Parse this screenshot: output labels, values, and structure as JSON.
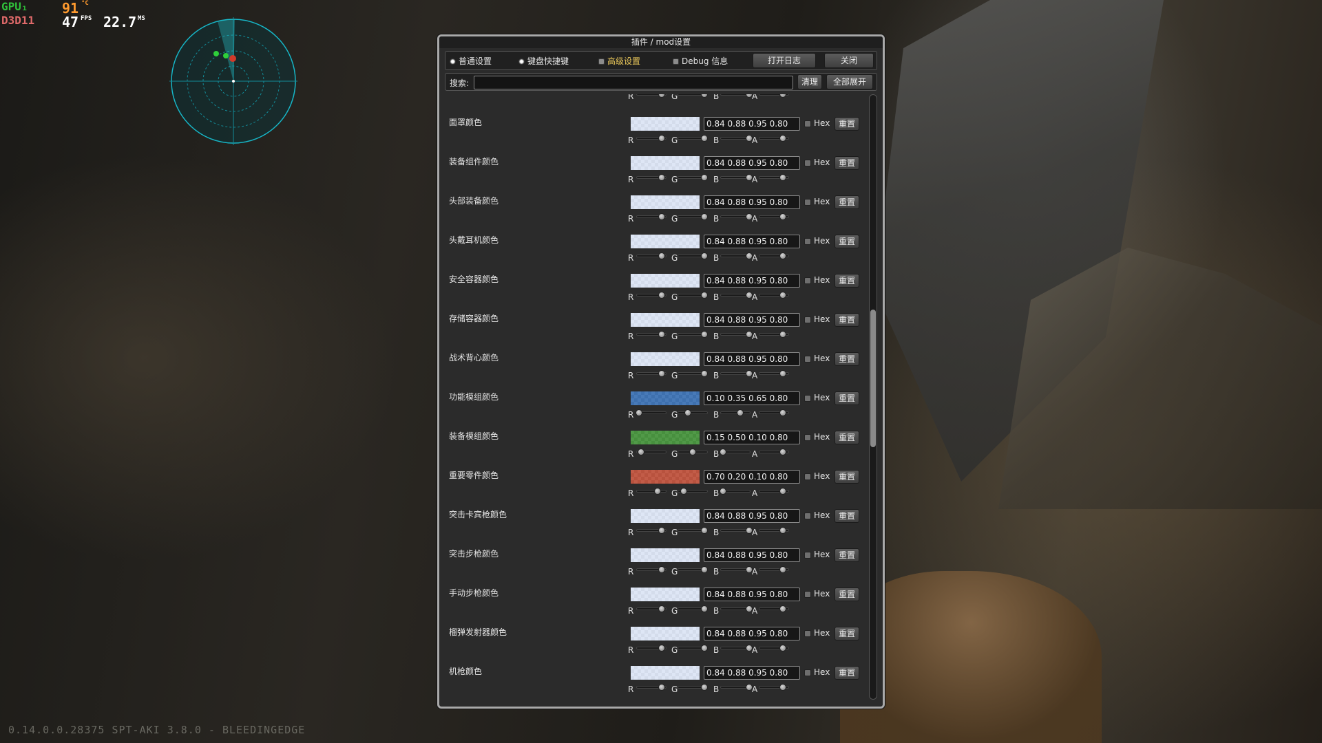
{
  "overlay": {
    "gpu_label": "GPU₁",
    "api_label": "D3D11",
    "temp": "91",
    "temp_unit": "°C",
    "fps": "47",
    "fps_unit": "FPS",
    "frametime": "22.7",
    "frametime_unit": "MS"
  },
  "version": "0.14.0.0.28375 SPT-AKI 3.8.0 - BLEEDINGEDGE",
  "window": {
    "title": "插件 / mod设置",
    "tabs": [
      {
        "label": "普通设置",
        "selected": true
      },
      {
        "label": "键盘快捷键",
        "selected": true
      },
      {
        "label": "高级设置",
        "selected": false,
        "highlight": true
      },
      {
        "label": "Debug 信息",
        "selected": false
      }
    ],
    "open_log_label": "打开日志",
    "close_label": "关闭",
    "search_label": "搜索:",
    "search_value": "",
    "clear_label": "清理",
    "expand_all_label": "全部展开",
    "hex_label": "Hex",
    "reset_label": "重置",
    "channel_labels": [
      "R",
      "G",
      "B",
      "A"
    ],
    "scroll_position": 0.46,
    "rows": [
      {
        "label": "面罩颜色",
        "value": "0.84 0.88 0.95 0.80",
        "color": "#d6e0f2",
        "rgba": [
          0.84,
          0.88,
          0.95,
          0.8
        ]
      },
      {
        "label": "装备组件颜色",
        "value": "0.84 0.88 0.95 0.80",
        "color": "#d6e0f2",
        "rgba": [
          0.84,
          0.88,
          0.95,
          0.8
        ]
      },
      {
        "label": "头部装备颜色",
        "value": "0.84 0.88 0.95 0.80",
        "color": "#d6e0f2",
        "rgba": [
          0.84,
          0.88,
          0.95,
          0.8
        ]
      },
      {
        "label": "头戴耳机颜色",
        "value": "0.84 0.88 0.95 0.80",
        "color": "#d6e0f2",
        "rgba": [
          0.84,
          0.88,
          0.95,
          0.8
        ]
      },
      {
        "label": "安全容器颜色",
        "value": "0.84 0.88 0.95 0.80",
        "color": "#d6e0f2",
        "rgba": [
          0.84,
          0.88,
          0.95,
          0.8
        ]
      },
      {
        "label": "存储容器颜色",
        "value": "0.84 0.88 0.95 0.80",
        "color": "#d6e0f2",
        "rgba": [
          0.84,
          0.88,
          0.95,
          0.8
        ]
      },
      {
        "label": "战术背心颜色",
        "value": "0.84 0.88 0.95 0.80",
        "color": "#d6e0f2",
        "rgba": [
          0.84,
          0.88,
          0.95,
          0.8
        ]
      },
      {
        "label": "功能模组颜色",
        "value": "0.10 0.35 0.65 0.80",
        "color": "#1a59a6",
        "rgba": [
          0.1,
          0.35,
          0.65,
          0.8
        ]
      },
      {
        "label": "装备模组颜色",
        "value": "0.15 0.50 0.10 0.80",
        "color": "#26801a",
        "rgba": [
          0.15,
          0.5,
          0.1,
          0.8
        ]
      },
      {
        "label": "重要零件颜色",
        "value": "0.70 0.20 0.10 0.80",
        "color": "#b3331a",
        "rgba": [
          0.7,
          0.2,
          0.1,
          0.8
        ]
      },
      {
        "label": "突击卡宾枪颜色",
        "value": "0.84 0.88 0.95 0.80",
        "color": "#d6e0f2",
        "rgba": [
          0.84,
          0.88,
          0.95,
          0.8
        ]
      },
      {
        "label": "突击步枪颜色",
        "value": "0.84 0.88 0.95 0.80",
        "color": "#d6e0f2",
        "rgba": [
          0.84,
          0.88,
          0.95,
          0.8
        ]
      },
      {
        "label": "手动步枪颜色",
        "value": "0.84 0.88 0.95 0.80",
        "color": "#d6e0f2",
        "rgba": [
          0.84,
          0.88,
          0.95,
          0.8
        ]
      },
      {
        "label": "榴弹发射器颜色",
        "value": "0.84 0.88 0.95 0.80",
        "color": "#d6e0f2",
        "rgba": [
          0.84,
          0.88,
          0.95,
          0.8
        ]
      },
      {
        "label": "机枪颜色",
        "value": "0.84 0.88 0.95 0.80",
        "color": "#d6e0f2",
        "rgba": [
          0.84,
          0.88,
          0.95,
          0.8
        ]
      }
    ],
    "top_partial_rgba": [
      0.84,
      0.88,
      0.95,
      0.8
    ]
  }
}
